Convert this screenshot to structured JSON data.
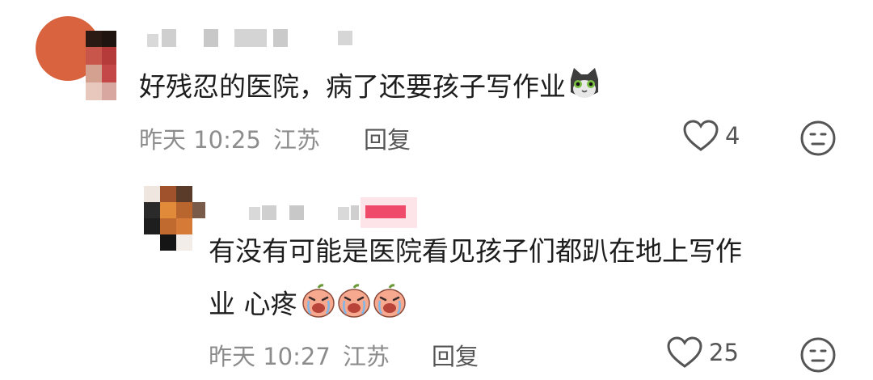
{
  "comment1": {
    "text": "好残忍的医院，病了还要孩子写作业",
    "emoji": "cat-emoji",
    "time": "昨天 10:25",
    "location": "江苏",
    "reply_label": "回复",
    "likes": "4"
  },
  "comment2": {
    "text_line1": "有没有可能是医院看见孩子们都趴在地上写作",
    "text_line2": "业 心疼",
    "emoji": "crying-peach-emoji",
    "emoji_count": 3,
    "time": "昨天 10:27",
    "location": "江苏",
    "reply_label": "回复",
    "likes": "25"
  },
  "colors": {
    "meta": "#8c8c8c",
    "text": "#1d1d1d",
    "icon": "#555555",
    "peach": "#f6a98f",
    "username_highlight": "#f04a6a"
  }
}
